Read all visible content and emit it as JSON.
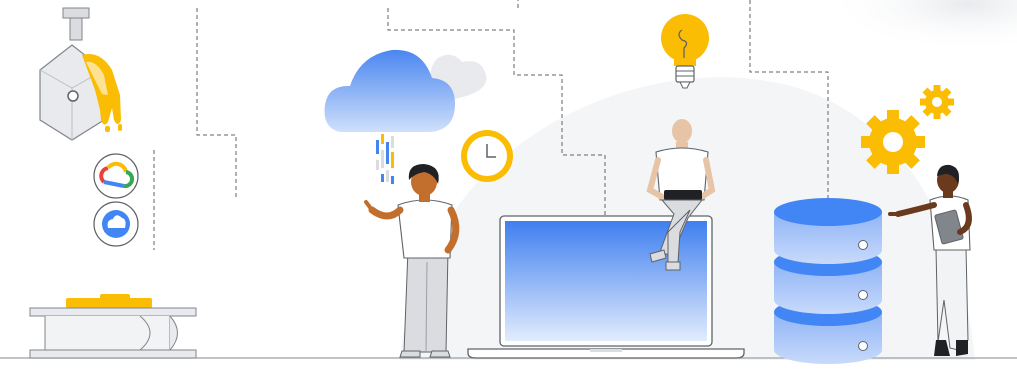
{
  "illustration": {
    "theme": "cloud-data-infrastructure",
    "icons": [
      "pouring-ladle-icon",
      "google-cloud-logo-icon",
      "cloud-storage-icon",
      "cloud-icon",
      "clock-icon",
      "lightbulb-icon",
      "laptop-icon",
      "database-icon",
      "gear-icon",
      "tablet-icon"
    ],
    "colors": {
      "accent_yellow": "#fbbc04",
      "light_yellow": "#fde293",
      "blue": "#4285f4",
      "light_blue": "#aecbfa",
      "red": "#ea4335",
      "green": "#34a853",
      "gray": "#dadce0",
      "line": "#5f6368"
    }
  }
}
